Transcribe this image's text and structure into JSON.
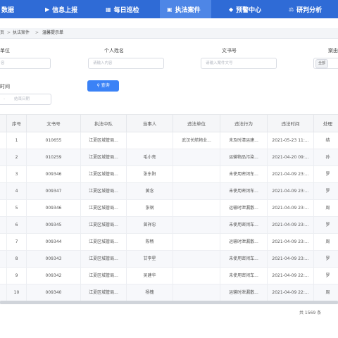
{
  "nav": [
    {
      "label": "数据",
      "icon": "database-icon",
      "glyph": ""
    },
    {
      "label": "信息上报",
      "icon": "truck-icon",
      "glyph": "🚚"
    },
    {
      "label": "每日巡检",
      "icon": "calendar-icon",
      "glyph": "▦"
    },
    {
      "label": "执法案件",
      "icon": "briefcase-icon",
      "glyph": "▣"
    },
    {
      "label": "预警中心",
      "icon": "shield-icon",
      "glyph": "◆"
    },
    {
      "label": "研判分析",
      "icon": "scale-icon",
      "glyph": "⚖"
    }
  ],
  "breadcrumb": [
    "页",
    "执法案件",
    "温馨提示单"
  ],
  "filters": {
    "unit_label": "单位",
    "unit_placeholder": "容",
    "person_label": "个人姓名",
    "person_placeholder": "请输入内容",
    "doc_label": "文书号",
    "doc_placeholder": "请输入案件文号",
    "right_label": "案由",
    "right_chip": "全部",
    "time_label": "时间",
    "date_start": "",
    "date_to": "-",
    "date_end": "结束日期",
    "query_label": "查询"
  },
  "table": {
    "headers": [
      "",
      "序号",
      "文书号",
      "执法中队",
      "当事人",
      "违法单位",
      "违法行为",
      "违法时间",
      "处理"
    ],
    "rows": [
      [
        "1",
        "010655",
        "江夏区城管局...",
        "",
        "武汉长航物业...",
        "未及时清运建...",
        "2021-05-23 11:...",
        "结"
      ],
      [
        "2",
        "010259",
        "江夏区城管局...",
        "毛小亮",
        "",
        "运输物品污染...",
        "2021-04-20 09:...",
        "孙"
      ],
      [
        "3",
        "009346",
        "江夏区城管局...",
        "张东阳",
        "",
        "未使用密闭车...",
        "2021-04-09 23:...",
        "罗"
      ],
      [
        "4",
        "009347",
        "江夏区城管局...",
        "黄念",
        "",
        "未使用密闭车...",
        "2021-04-09 23:...",
        "罗"
      ],
      [
        "5",
        "009346",
        "江夏区城管局...",
        "张钢",
        "",
        "运输时泄漏散...",
        "2021-04-09 23:...",
        "周"
      ],
      [
        "6",
        "009345",
        "江夏区城管局...",
        "曾祥忠",
        "",
        "未使用密闭车...",
        "2021-04-09 23:...",
        "罗"
      ],
      [
        "7",
        "009344",
        "江夏区城管局...",
        "陈畅",
        "",
        "运输时泄漏散...",
        "2021-04-09 23:...",
        "周"
      ],
      [
        "8",
        "009343",
        "江夏区城管局...",
        "甘李星",
        "",
        "未使用密闭车...",
        "2021-04-09 23:...",
        "罗"
      ],
      [
        "9",
        "009342",
        "江夏区城管局...",
        "吴建华",
        "",
        "未使用密闭车...",
        "2021-04-09 22:...",
        "罗"
      ],
      [
        "10",
        "009340",
        "江夏区城管局...",
        "杨槐",
        "",
        "运输时泄漏散...",
        "2021-04-09 22:...",
        "周"
      ]
    ]
  },
  "footer": {
    "total": "共 1569 条"
  },
  "colors": {
    "nav_bg": "#2f6bd6",
    "nav_active": "#4e86e6",
    "button": "#3b82f6"
  }
}
